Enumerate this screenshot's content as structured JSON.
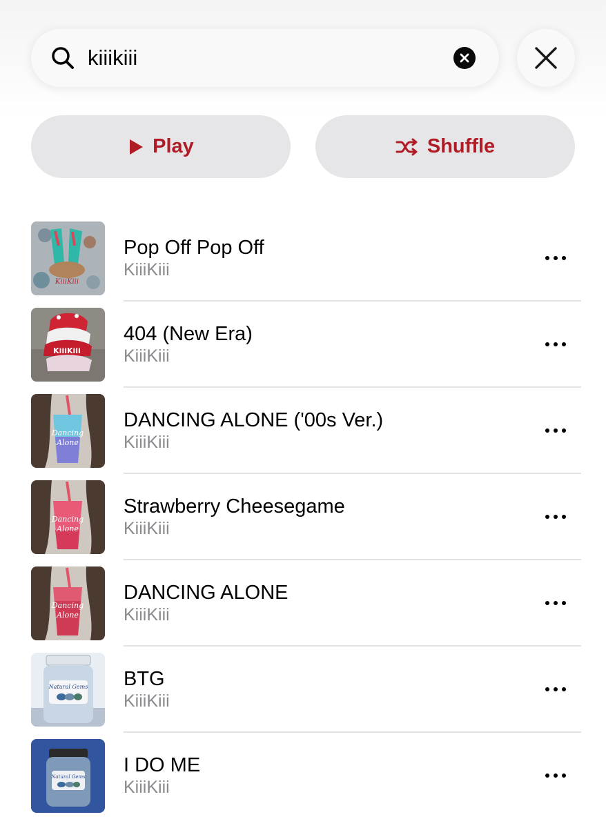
{
  "search": {
    "query": "kiiikiii",
    "icon": "search-icon",
    "clear_icon": "clear-icon",
    "close_icon": "close-icon"
  },
  "actions": {
    "play_label": "Play",
    "shuffle_label": "Shuffle",
    "accent_color": "#b01c26",
    "button_bg": "#e6e6e8"
  },
  "tracks": [
    {
      "title": "Pop Off Pop Off",
      "artist": "KiiiKiii",
      "art": "flip-flops-art"
    },
    {
      "title": "404 (New Era)",
      "artist": "KiiiKiii",
      "art": "caps-art"
    },
    {
      "title": "DANCING ALONE ('00s Ver.)",
      "artist": "KiiiKiii",
      "art": "blue-drink-art"
    },
    {
      "title": "Strawberry Cheesegame",
      "artist": "KiiiKiii",
      "art": "pink-drink-art"
    },
    {
      "title": "DANCING ALONE",
      "artist": "KiiiKiii",
      "art": "pink-drink-art"
    },
    {
      "title": "BTG",
      "artist": "KiiiKiii",
      "art": "jar-art"
    },
    {
      "title": "I DO ME",
      "artist": "KiiiKiii",
      "art": "jar-blue-art"
    }
  ]
}
